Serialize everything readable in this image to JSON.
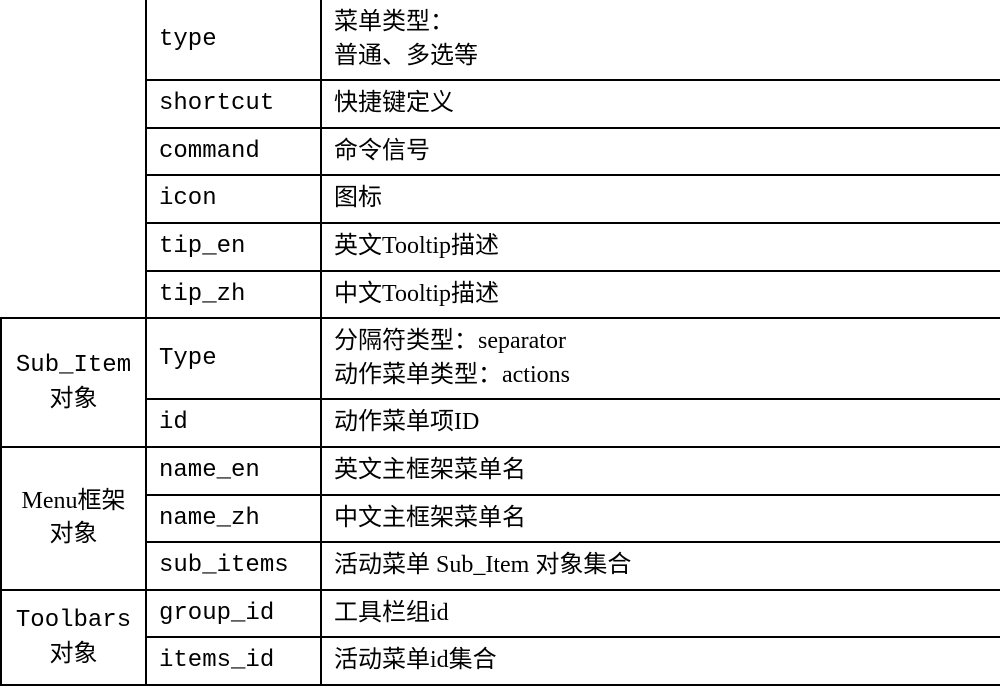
{
  "rows": [
    {
      "group": "",
      "field": "type",
      "desc": "菜单类型：\n普通、多选等"
    },
    {
      "group": "",
      "field": "shortcut",
      "desc": "快捷键定义"
    },
    {
      "group": "",
      "field": "command",
      "desc": "命令信号"
    },
    {
      "group": "",
      "field": "icon",
      "desc": "图标"
    },
    {
      "group": "",
      "field": "tip_en",
      "desc": "英文Tooltip描述"
    },
    {
      "group": "",
      "field": "tip_zh",
      "desc": "中文Tooltip描述"
    },
    {
      "group": "Sub_Item\n对象",
      "field": "Type",
      "desc": "分隔符类型：separator\n动作菜单类型：actions"
    },
    {
      "group": "",
      "field": "id",
      "desc": "动作菜单项ID"
    },
    {
      "group": "Menu框架\n对象",
      "field": "name_en",
      "desc": "英文主框架菜单名"
    },
    {
      "group": "",
      "field": "name_zh",
      "desc": "中文主框架菜单名"
    },
    {
      "group": "",
      "field": "sub_items",
      "desc": "活动菜单 Sub_Item 对象集合"
    },
    {
      "group": "Toolbars\n对象",
      "field": "group_id",
      "desc": "工具栏组id"
    },
    {
      "group": "",
      "field": "items_id",
      "desc": "活动菜单id集合"
    }
  ],
  "groups": {
    "blank": "",
    "sub_item": "Sub_Item\n对象",
    "menu": "Menu框架\n对象",
    "toolbars": "Toolbars\n对象"
  },
  "fields": {
    "r0": "type",
    "r1": "shortcut",
    "r2": "command",
    "r3": "icon",
    "r4": "tip_en",
    "r5": "tip_zh",
    "r6": "Type",
    "r7": "id",
    "r8": "name_en",
    "r9": "name_zh",
    "r10": "sub_items",
    "r11": "group_id",
    "r12": "items_id"
  },
  "descs": {
    "r0a": "菜单类型：",
    "r0b": "普通、多选等",
    "r1": "快捷键定义",
    "r2": "命令信号",
    "r3": "图标",
    "r4": "英文Tooltip描述",
    "r5": "中文Tooltip描述",
    "r6a": "分隔符类型：separator",
    "r6b": "动作菜单类型：actions",
    "r7": "动作菜单项ID",
    "r8": "英文主框架菜单名",
    "r9": "中文主框架菜单名",
    "r10": "活动菜单 Sub_Item 对象集合",
    "r11": "工具栏组id",
    "r12": "活动菜单id集合"
  }
}
